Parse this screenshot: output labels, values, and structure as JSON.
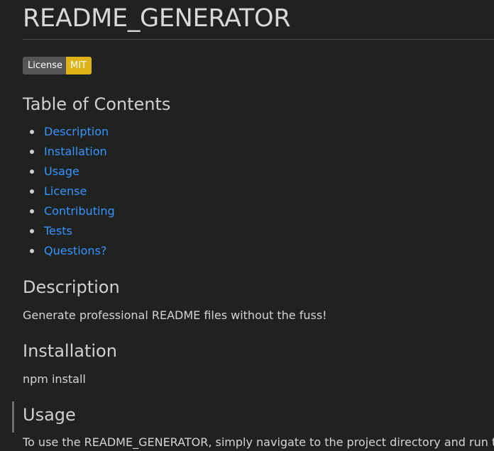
{
  "title": "README_GENERATOR",
  "badge": {
    "left": "License",
    "right": "MIT",
    "right_color": "#dfb317"
  },
  "toc": {
    "heading": "Table of Contents",
    "items": [
      {
        "label": "Description"
      },
      {
        "label": "Installation"
      },
      {
        "label": "Usage"
      },
      {
        "label": "License"
      },
      {
        "label": "Contributing"
      },
      {
        "label": "Tests"
      },
      {
        "label": "Questions?"
      }
    ]
  },
  "description": {
    "heading": "Description",
    "text": "Generate professional README files without the fuss!"
  },
  "installation": {
    "heading": "Installation",
    "text": "npm install"
  },
  "usage": {
    "heading": "Usage",
    "text": "To use the README_GENERATOR, simply navigate to the project directory and run the"
  },
  "colors": {
    "background": "#1f221f",
    "link": "#3794ff",
    "text": "#d4d4d4"
  }
}
